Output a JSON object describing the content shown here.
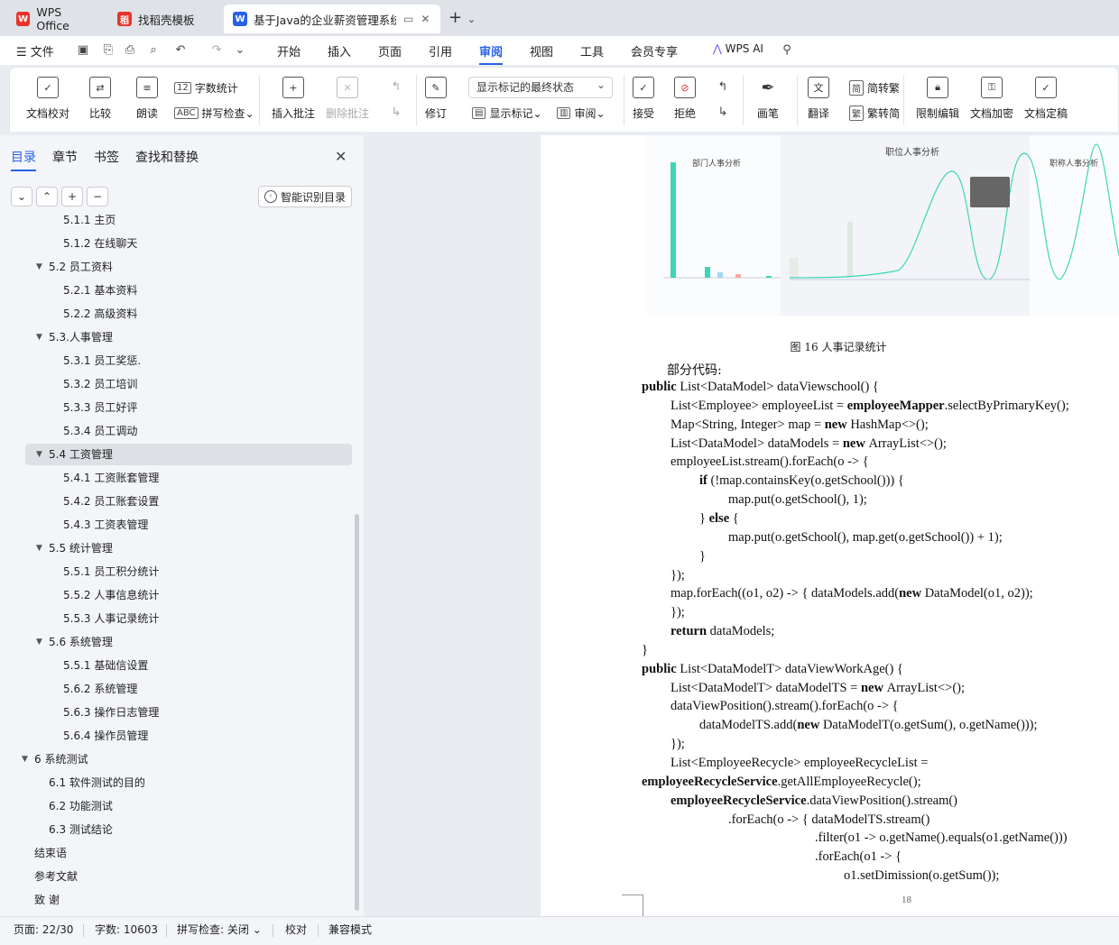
{
  "tabs": [
    {
      "label": "WPS Office",
      "icon": "wps-logo-icon",
      "color": "#e8352a"
    },
    {
      "label": "找稻壳模板",
      "icon": "docer-icon",
      "color": "#e8352a"
    },
    {
      "label": "基于Java的企业薪资管理系统",
      "icon": "writer-doc-icon",
      "color": "#2a62e6"
    }
  ],
  "menu": {
    "file": "文件",
    "items": [
      "开始",
      "插入",
      "页面",
      "引用",
      "审阅",
      "视图",
      "工具",
      "会员专享"
    ],
    "active": "审阅",
    "wps_ai": "WPS AI"
  },
  "ribbon": {
    "doc_check": "文档校对",
    "compare": "比较",
    "read_aloud": "朗读",
    "word_count": "字数统计",
    "spell_check": "拼写检查",
    "insert_comment": "插入批注",
    "delete_comment": "删除批注",
    "revise": "修订",
    "markup_select": "显示标记的最终状态",
    "show_markup": "显示标记",
    "review": "审阅",
    "accept": "接受",
    "reject": "拒绝",
    "pen": "画笔",
    "translate": "翻译",
    "to_traditional": "简转繁",
    "to_simplified": "繁转简",
    "restrict_edit": "限制编辑",
    "encrypt": "文档加密",
    "finalize": "文档定稿"
  },
  "nav": {
    "tabs": [
      "目录",
      "章节",
      "书签",
      "查找和替换"
    ],
    "smart_toc": "智能识别目录",
    "toc": [
      {
        "label": "5.1.1 主页",
        "level": 3
      },
      {
        "label": "5.1.2 在线聊天",
        "level": 3
      },
      {
        "label": "5.2  员工资料",
        "level": 2,
        "caret": true
      },
      {
        "label": "5.2.1 基本资料",
        "level": 3
      },
      {
        "label": "5.2.2  高级资料",
        "level": 3
      },
      {
        "label": "5.3.人事管理",
        "level": 2,
        "caret": true
      },
      {
        "label": "5.3.1 员工奖惩.",
        "level": 3
      },
      {
        "label": "5.3.2 员工培训",
        "level": 3
      },
      {
        "label": "5.3.3 员工好评",
        "level": 3
      },
      {
        "label": "5.3.4 员工调动",
        "level": 3
      },
      {
        "label": "5.4 工资管理",
        "level": 2,
        "caret": true,
        "selected": true
      },
      {
        "label": "5.4.1 工资账套管理",
        "level": 3
      },
      {
        "label": "5.4.2 员工账套设置",
        "level": 3
      },
      {
        "label": "5.4.3 工资表管理",
        "level": 3
      },
      {
        "label": "5.5 统计管理",
        "level": 2,
        "caret": true
      },
      {
        "label": "5.5.1 员工积分统计",
        "level": 3
      },
      {
        "label": "5.5.2 人事信息统计",
        "level": 3
      },
      {
        "label": "5.5.3 人事记录统计",
        "level": 3
      },
      {
        "label": "5.6 系统管理",
        "level": 2,
        "caret": true
      },
      {
        "label": "5.5.1 基础信设置",
        "level": 3
      },
      {
        "label": "5.6.2 系统管理",
        "level": 3
      },
      {
        "label": "5.6.3 操作日志管理",
        "level": 3
      },
      {
        "label": "5.6.4 操作员管理",
        "level": 3
      },
      {
        "label": "6 系统测试",
        "level": 1,
        "caret": true
      },
      {
        "label": "6.1  软件测试的目的",
        "level": 2
      },
      {
        "label": "6.2  功能测试",
        "level": 2
      },
      {
        "label": "6.3  测试结论",
        "level": 2
      },
      {
        "label": "结束语",
        "level": 1
      },
      {
        "label": "参考文献",
        "level": 1
      },
      {
        "label": "致   谢",
        "level": 1
      }
    ]
  },
  "document": {
    "chart_titles": [
      "部门人事分析",
      "职位人事分析",
      "职称人事分析"
    ],
    "caption": "图 16 人事记录统计",
    "intro": "部分代码:",
    "page_number": "18",
    "code_lines": [
      {
        "indent": 0,
        "parts": [
          {
            "b": true,
            "t": "public "
          },
          {
            "t": "List<DataModel> dataViewschool() {"
          }
        ]
      },
      {
        "indent": 1,
        "parts": [
          {
            "t": "List<Employee> employeeList = "
          },
          {
            "b": true,
            "t": "employeeMapper"
          },
          {
            "t": ".selectByPrimaryKey();"
          }
        ]
      },
      {
        "indent": 1,
        "parts": [
          {
            "t": "Map<String, Integer> map = "
          },
          {
            "b": true,
            "t": "new "
          },
          {
            "t": "HashMap<>();"
          }
        ]
      },
      {
        "indent": 1,
        "parts": [
          {
            "t": "List<DataModel> dataModels = "
          },
          {
            "b": true,
            "t": "new "
          },
          {
            "t": "ArrayList<>();"
          }
        ]
      },
      {
        "indent": 1,
        "parts": [
          {
            "t": "employeeList.stream().forEach(o -> {"
          }
        ]
      },
      {
        "indent": 2,
        "parts": [
          {
            "b": true,
            "t": "if "
          },
          {
            "t": "(!map.containsKey(o.getSchool())) {"
          }
        ]
      },
      {
        "indent": 3,
        "parts": [
          {
            "t": "map.put(o.getSchool(), 1);"
          }
        ]
      },
      {
        "indent": 2,
        "parts": [
          {
            "t": "} "
          },
          {
            "b": true,
            "t": "else "
          },
          {
            "t": "{"
          }
        ]
      },
      {
        "indent": 3,
        "parts": [
          {
            "t": "map.put(o.getSchool(), map.get(o.getSchool()) + 1);"
          }
        ]
      },
      {
        "indent": 2,
        "parts": [
          {
            "t": "}"
          }
        ]
      },
      {
        "indent": 1,
        "parts": [
          {
            "t": "});"
          }
        ]
      },
      {
        "indent": 1,
        "parts": [
          {
            "t": "map.forEach((o1, o2) -> { dataModels.add("
          },
          {
            "b": true,
            "t": "new "
          },
          {
            "t": "DataModel(o1, o2));"
          }
        ]
      },
      {
        "indent": 1,
        "parts": [
          {
            "t": "});"
          }
        ]
      },
      {
        "indent": 1,
        "parts": [
          {
            "b": true,
            "t": "return "
          },
          {
            "t": "dataModels;"
          }
        ]
      },
      {
        "indent": 0,
        "parts": [
          {
            "t": "}"
          }
        ]
      },
      {
        "indent": 0,
        "parts": [
          {
            "b": true,
            "t": "public "
          },
          {
            "t": "List<DataModelT> dataViewWorkAge() {"
          }
        ]
      },
      {
        "indent": 1,
        "parts": [
          {
            "t": "List<DataModelT> dataModelTS = "
          },
          {
            "b": true,
            "t": "new "
          },
          {
            "t": "ArrayList<>();"
          }
        ]
      },
      {
        "indent": 1,
        "parts": [
          {
            "t": "dataViewPosition().stream().forEach(o -> {"
          }
        ]
      },
      {
        "indent": 2,
        "parts": [
          {
            "t": "dataModelTS.add("
          },
          {
            "b": true,
            "t": "new "
          },
          {
            "t": "DataModelT(o.getSum(), o.getName()));"
          }
        ]
      },
      {
        "indent": 1,
        "parts": [
          {
            "t": "});"
          }
        ]
      },
      {
        "indent": 1,
        "parts": [
          {
            "t": "List<EmployeeRecycle> employeeRecycleList ="
          }
        ]
      },
      {
        "indent": 0,
        "parts": [
          {
            "b": true,
            "t": "employeeRecycleService"
          },
          {
            "t": ".getAllEmployeeRecycle();"
          }
        ]
      },
      {
        "indent": 1,
        "parts": [
          {
            "b": true,
            "t": "employeeRecycleService"
          },
          {
            "t": ".dataViewPosition().stream()"
          }
        ]
      },
      {
        "indent": 3,
        "parts": [
          {
            "t": ".forEach(o -> { dataModelTS.stream()"
          }
        ]
      },
      {
        "indent": 6,
        "parts": [
          {
            "t": ".filter(o1 -> o.getName().equals(o1.getName()))"
          }
        ]
      },
      {
        "indent": 6,
        "parts": [
          {
            "t": ".forEach(o1 -> {"
          }
        ]
      },
      {
        "indent": 7,
        "parts": [
          {
            "t": "o1.setDimission(o.getSum());"
          }
        ]
      }
    ]
  },
  "status": {
    "page": "页面: 22/30",
    "words": "字数: 10603",
    "spell": "拼写检查: 关闭",
    "proof": "校对",
    "compat": "兼容模式"
  },
  "colors": {
    "accent": "#2a62e6",
    "chart_teal": "#3dd6b5"
  }
}
